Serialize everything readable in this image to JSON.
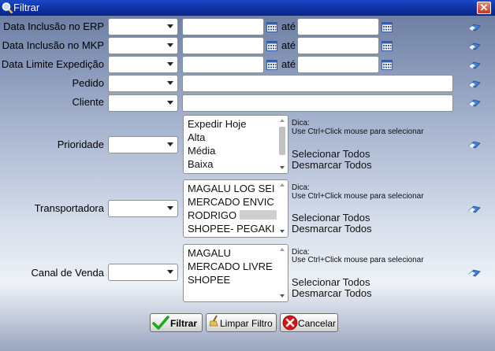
{
  "window": {
    "title": "Filtrar",
    "close_glyph": "✕"
  },
  "range_separator": "até",
  "fields": {
    "data_erp": {
      "label": "Data Inclusão no ERP"
    },
    "data_mkp": {
      "label": "Data Inclusão no MKP"
    },
    "data_limite": {
      "label": "Data Limite Expedição"
    },
    "pedido": {
      "label": "Pedido"
    },
    "cliente": {
      "label": "Cliente"
    },
    "prioridade": {
      "label": "Prioridade",
      "options": [
        "Expedir Hoje",
        "Alta",
        "Média",
        "Baixa"
      ]
    },
    "transportadora": {
      "label": "Transportadora",
      "options": [
        "MAGALU LOG SEI",
        "MERCADO ENVIC",
        "RODRIGO",
        "SHOPEE- PEGAKI"
      ]
    },
    "canal_venda": {
      "label": "Canal de Venda",
      "options": [
        "MAGALU",
        "MERCADO LIVRE",
        "SHOPEE"
      ]
    }
  },
  "multi_select": {
    "hint_title": "Dica:",
    "hint_text": "Use Ctrl+Click mouse para selecionar",
    "select_all": "Selecionar Todos",
    "deselect_all": "Desmarcar Todos"
  },
  "buttons": {
    "filter": "Filtrar",
    "clear": "Limpar Filtro",
    "cancel": "Cancelar"
  },
  "icons": {
    "window": "search-icon",
    "calendar": "calendar-icon",
    "clear_field": "eraser-icon",
    "filter": "checkmark-icon",
    "clear": "broom-icon",
    "cancel": "cancel-icon"
  },
  "colors": {
    "titlebar": "#0e2f9f",
    "close_button": "#c23b1e",
    "filter_check": "#22a61a",
    "cancel_red": "#d41414"
  }
}
